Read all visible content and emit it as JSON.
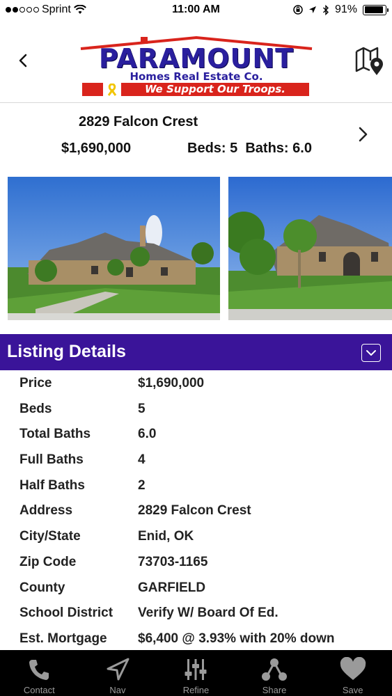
{
  "status_bar": {
    "carrier": "Sprint",
    "time": "11:00 AM",
    "battery": "91%",
    "battery_level": 0.91,
    "signal_bars_filled": 2,
    "signal_bars_total": 5
  },
  "header": {
    "back_icon": "chevron-left-icon",
    "map_icon": "map-pin-icon",
    "logo": {
      "name": "PARAMOUNT",
      "tagline": "Homes Real Estate Co.",
      "slogan": "We Support Our Troops.",
      "brand_color": "#2a1f9e",
      "accent_color": "#d9241c"
    }
  },
  "summary": {
    "address": "2829 Falcon Crest",
    "price": "$1,690,000",
    "beds_baths": "Beds: 5  Baths: 6.0",
    "next_icon": "chevron-right-icon"
  },
  "photos": [
    {
      "name": "house-photo-front"
    },
    {
      "name": "house-photo-side"
    }
  ],
  "listing_details": {
    "title": "Listing Details",
    "bar_color": "#3a1499",
    "collapse_icon": "chevron-down-icon",
    "rows": [
      {
        "label": "Price",
        "value": "$1,690,000"
      },
      {
        "label": "Beds",
        "value": "5"
      },
      {
        "label": "Total Baths",
        "value": "6.0"
      },
      {
        "label": "Full Baths",
        "value": "4"
      },
      {
        "label": "Half Baths",
        "value": "2"
      },
      {
        "label": "Address",
        "value": "2829 Falcon Crest"
      },
      {
        "label": "City/State",
        "value": "Enid, OK"
      },
      {
        "label": "Zip Code",
        "value": "73703-1165"
      },
      {
        "label": "County",
        "value": "GARFIELD"
      },
      {
        "label": "School District",
        "value": "Verify W/ Board Of Ed."
      },
      {
        "label": "Est. Mortgage",
        "value": "$6,400 @ 3.93% with 20% down"
      }
    ]
  },
  "tab_bar": {
    "tabs": [
      {
        "label": "Contact",
        "icon": "phone-icon"
      },
      {
        "label": "Nav",
        "icon": "navigation-arrow-icon"
      },
      {
        "label": "Refine",
        "icon": "sliders-icon"
      },
      {
        "label": "Share",
        "icon": "share-icon"
      },
      {
        "label": "Save",
        "icon": "heart-icon"
      }
    ]
  }
}
